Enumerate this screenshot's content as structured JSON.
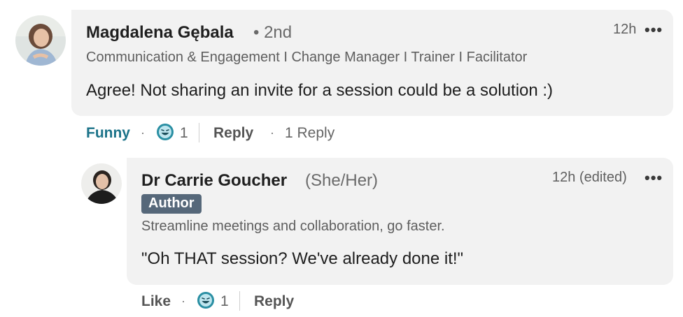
{
  "comment1": {
    "author": "Magdalena Gębala",
    "degree": "• 2nd",
    "headline": "Communication & Engagement I Change Manager I Trainer I Facilitator",
    "text": "Agree! Not sharing an invite for a session could be a solution :)",
    "time": "12h",
    "more": "•••",
    "reaction_label": "Funny",
    "reaction_icon": "laugh-icon",
    "reaction_count": "1",
    "reply_label": "Reply",
    "replies_count": "1 Reply"
  },
  "comment2": {
    "author": "Dr Carrie Goucher",
    "pronouns": "(She/Her)",
    "badge": "Author",
    "headline": "Streamline meetings and collaboration, go faster.",
    "text": "\"Oh THAT session? We've already done it!\"",
    "time": "12h (edited)",
    "more": "•••",
    "like_label": "Like",
    "reaction_icon": "laugh-icon",
    "reaction_count": "1",
    "reply_label": "Reply"
  },
  "colors": {
    "bubble": "#f2f2f2",
    "funny": "#1c7389",
    "badge": "#56687a",
    "reaction_fill": "#2a8fa3"
  }
}
